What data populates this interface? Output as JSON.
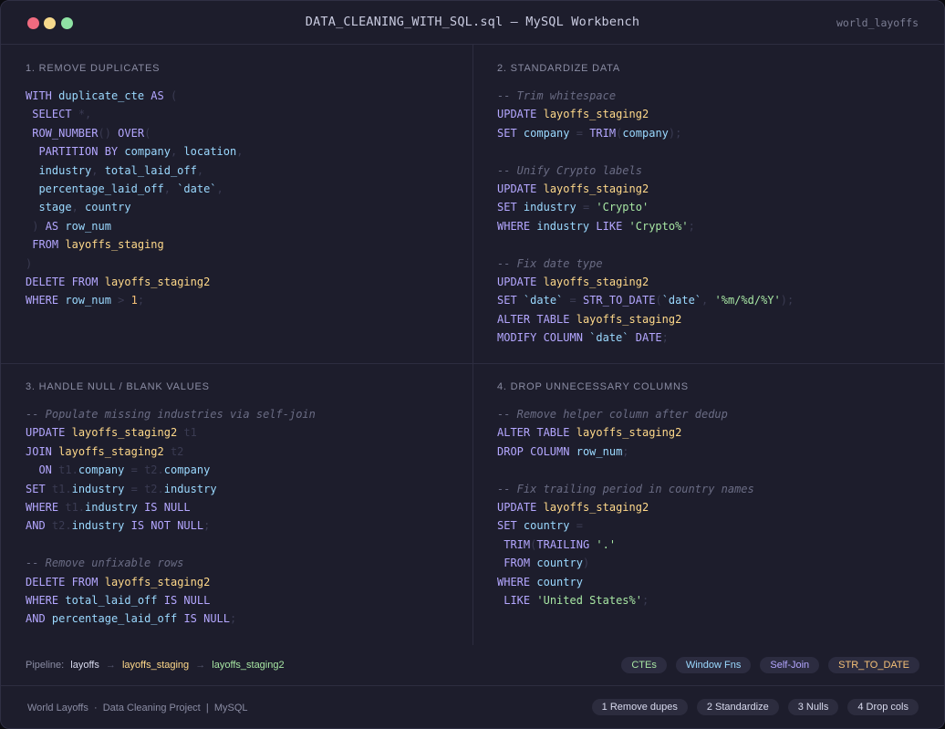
{
  "window": {
    "title": "DATA_CLEANING_WITH_SQL.sql  —  MySQL Workbench",
    "database": "world_layoffs",
    "traffic_lights": [
      "#f06b80",
      "#f6d98c",
      "#8fe3a4"
    ]
  },
  "panels": [
    {
      "title": "1. REMOVE DUPLICATES",
      "lines": [
        [
          [
            "kw",
            "WITH"
          ],
          [
            "p",
            " "
          ],
          [
            "id",
            "duplicate_cte"
          ],
          [
            "p",
            " "
          ],
          [
            "kw",
            "AS"
          ],
          [
            "p",
            " ("
          ]
        ],
        [
          [
            "p",
            " "
          ],
          [
            "kw",
            "SELECT"
          ],
          [
            "p",
            " *,"
          ]
        ],
        [
          [
            "p",
            " "
          ],
          [
            "kw",
            "ROW_NUMBER"
          ],
          [
            "p",
            "() "
          ],
          [
            "kw",
            "OVER"
          ],
          [
            "p",
            "("
          ]
        ],
        [
          [
            "p",
            "  "
          ],
          [
            "kw",
            "PARTITION BY"
          ],
          [
            "p",
            " "
          ],
          [
            "id",
            "company"
          ],
          [
            "p",
            ", "
          ],
          [
            "id",
            "location"
          ],
          [
            "p",
            ","
          ]
        ],
        [
          [
            "p",
            "  "
          ],
          [
            "id",
            "industry"
          ],
          [
            "p",
            ", "
          ],
          [
            "id",
            "total_laid_off"
          ],
          [
            "p",
            ","
          ]
        ],
        [
          [
            "p",
            "  "
          ],
          [
            "id",
            "percentage_laid_off"
          ],
          [
            "p",
            ", "
          ],
          [
            "id",
            "`date`"
          ],
          [
            "p",
            ","
          ]
        ],
        [
          [
            "p",
            "  "
          ],
          [
            "id",
            "stage"
          ],
          [
            "p",
            ", "
          ],
          [
            "id",
            "country"
          ]
        ],
        [
          [
            "p",
            " ) "
          ],
          [
            "kw",
            "AS"
          ],
          [
            "p",
            " "
          ],
          [
            "id",
            "row_num"
          ]
        ],
        [
          [
            "p",
            " "
          ],
          [
            "kw",
            "FROM"
          ],
          [
            "p",
            " "
          ],
          [
            "tb",
            "layoffs_staging"
          ]
        ],
        [
          [
            "p",
            ")"
          ]
        ],
        [
          [
            "kw",
            "DELETE FROM"
          ],
          [
            "p",
            " "
          ],
          [
            "tb",
            "layoffs_staging2"
          ]
        ],
        [
          [
            "kw",
            "WHERE"
          ],
          [
            "p",
            " "
          ],
          [
            "id",
            "row_num"
          ],
          [
            "p",
            " > "
          ],
          [
            "num",
            "1"
          ],
          [
            "p",
            ";"
          ]
        ]
      ]
    },
    {
      "title": "2. STANDARDIZE DATA",
      "lines": [
        [
          [
            "cm",
            "-- Trim whitespace"
          ]
        ],
        [
          [
            "kw",
            "UPDATE"
          ],
          [
            "p",
            " "
          ],
          [
            "tb",
            "layoffs_staging2"
          ]
        ],
        [
          [
            "kw",
            "SET"
          ],
          [
            "p",
            " "
          ],
          [
            "id",
            "company"
          ],
          [
            "p",
            " = "
          ],
          [
            "kw",
            "TRIM"
          ],
          [
            "p",
            "("
          ],
          [
            "id",
            "company"
          ],
          [
            "p",
            ");"
          ]
        ],
        [],
        [
          [
            "cm",
            "-- Unify Crypto labels"
          ]
        ],
        [
          [
            "kw",
            "UPDATE"
          ],
          [
            "p",
            " "
          ],
          [
            "tb",
            "layoffs_staging2"
          ]
        ],
        [
          [
            "kw",
            "SET"
          ],
          [
            "p",
            " "
          ],
          [
            "id",
            "industry"
          ],
          [
            "p",
            " = "
          ],
          [
            "str",
            "'Crypto'"
          ]
        ],
        [
          [
            "kw",
            "WHERE"
          ],
          [
            "p",
            " "
          ],
          [
            "id",
            "industry"
          ],
          [
            "p",
            " "
          ],
          [
            "kw",
            "LIKE"
          ],
          [
            "p",
            " "
          ],
          [
            "str",
            "'Crypto%'"
          ],
          [
            "p",
            ";"
          ]
        ],
        [],
        [
          [
            "cm",
            "-- Fix date type"
          ]
        ],
        [
          [
            "kw",
            "UPDATE"
          ],
          [
            "p",
            " "
          ],
          [
            "tb",
            "layoffs_staging2"
          ]
        ],
        [
          [
            "kw",
            "SET"
          ],
          [
            "p",
            " "
          ],
          [
            "id",
            "`date`"
          ],
          [
            "p",
            " = "
          ],
          [
            "kw",
            "STR_TO_DATE"
          ],
          [
            "p",
            "("
          ],
          [
            "id",
            "`date`"
          ],
          [
            "p",
            ", "
          ],
          [
            "str",
            "'%m/%d/%Y'"
          ],
          [
            "p",
            ");"
          ]
        ],
        [
          [
            "kw",
            "ALTER TABLE"
          ],
          [
            "p",
            " "
          ],
          [
            "tb",
            "layoffs_staging2"
          ]
        ],
        [
          [
            "kw",
            "MODIFY COLUMN"
          ],
          [
            "p",
            " "
          ],
          [
            "id",
            "`date`"
          ],
          [
            "p",
            " "
          ],
          [
            "kw",
            "DATE"
          ],
          [
            "p",
            ";"
          ]
        ]
      ]
    },
    {
      "title": "3. HANDLE NULL / BLANK VALUES",
      "lines": [
        [
          [
            "cm",
            "-- Populate missing industries via self-join"
          ]
        ],
        [
          [
            "kw",
            "UPDATE"
          ],
          [
            "p",
            " "
          ],
          [
            "tb",
            "layoffs_staging2"
          ],
          [
            "p",
            " t1"
          ]
        ],
        [
          [
            "kw",
            "JOIN"
          ],
          [
            "p",
            " "
          ],
          [
            "tb",
            "layoffs_staging2"
          ],
          [
            "p",
            " t2"
          ]
        ],
        [
          [
            "p",
            "  "
          ],
          [
            "kw",
            "ON"
          ],
          [
            "p",
            " t1."
          ],
          [
            "id",
            "company"
          ],
          [
            "p",
            " = t2."
          ],
          [
            "id",
            "company"
          ]
        ],
        [
          [
            "kw",
            "SET"
          ],
          [
            "p",
            " t1."
          ],
          [
            "id",
            "industry"
          ],
          [
            "p",
            " = t2."
          ],
          [
            "id",
            "industry"
          ]
        ],
        [
          [
            "kw",
            "WHERE"
          ],
          [
            "p",
            " t1."
          ],
          [
            "id",
            "industry"
          ],
          [
            "p",
            " "
          ],
          [
            "kw",
            "IS NULL"
          ]
        ],
        [
          [
            "kw",
            "AND"
          ],
          [
            "p",
            " t2."
          ],
          [
            "id",
            "industry"
          ],
          [
            "p",
            " "
          ],
          [
            "kw",
            "IS NOT NULL"
          ],
          [
            "p",
            ";"
          ]
        ],
        [],
        [
          [
            "cm",
            "-- Remove unfixable rows"
          ]
        ],
        [
          [
            "kw",
            "DELETE FROM"
          ],
          [
            "p",
            " "
          ],
          [
            "tb",
            "layoffs_staging2"
          ]
        ],
        [
          [
            "kw",
            "WHERE"
          ],
          [
            "p",
            " "
          ],
          [
            "id",
            "total_laid_off"
          ],
          [
            "p",
            " "
          ],
          [
            "kw",
            "IS NULL"
          ]
        ],
        [
          [
            "kw",
            "AND"
          ],
          [
            "p",
            " "
          ],
          [
            "id",
            "percentage_laid_off"
          ],
          [
            "p",
            " "
          ],
          [
            "kw",
            "IS NULL"
          ],
          [
            "p",
            ";"
          ]
        ]
      ]
    },
    {
      "title": "4. DROP UNNECESSARY COLUMNS",
      "lines": [
        [
          [
            "cm",
            "-- Remove helper column after dedup"
          ]
        ],
        [
          [
            "kw",
            "ALTER TABLE"
          ],
          [
            "p",
            " "
          ],
          [
            "tb",
            "layoffs_staging2"
          ]
        ],
        [
          [
            "kw",
            "DROP COLUMN"
          ],
          [
            "p",
            " "
          ],
          [
            "id",
            "row_num"
          ],
          [
            "p",
            ";"
          ]
        ],
        [],
        [
          [
            "cm",
            "-- Fix trailing period in country names"
          ]
        ],
        [
          [
            "kw",
            "UPDATE"
          ],
          [
            "p",
            " "
          ],
          [
            "tb",
            "layoffs_staging2"
          ]
        ],
        [
          [
            "kw",
            "SET"
          ],
          [
            "p",
            " "
          ],
          [
            "id",
            "country"
          ],
          [
            "p",
            " ="
          ]
        ],
        [
          [
            "p",
            " "
          ],
          [
            "kw",
            "TRIM"
          ],
          [
            "p",
            "("
          ],
          [
            "kw",
            "TRAILING"
          ],
          [
            "p",
            " "
          ],
          [
            "str",
            "'.'"
          ]
        ],
        [
          [
            "p",
            " "
          ],
          [
            "kw",
            "FROM"
          ],
          [
            "p",
            " "
          ],
          [
            "id",
            "country"
          ],
          [
            "p",
            ")"
          ]
        ],
        [
          [
            "kw",
            "WHERE"
          ],
          [
            "p",
            " "
          ],
          [
            "id",
            "country"
          ]
        ],
        [
          [
            "p",
            " "
          ],
          [
            "kw",
            "LIKE"
          ],
          [
            "p",
            " "
          ],
          [
            "str",
            "'United States%'"
          ],
          [
            "p",
            ";"
          ]
        ]
      ]
    }
  ],
  "pipeline": {
    "label": "Pipeline:",
    "stages": [
      "layoffs",
      "layoffs_staging",
      "layoffs_staging2"
    ],
    "arrow": "→"
  },
  "tags": [
    {
      "label": "CTEs",
      "color": "#a7e6a3"
    },
    {
      "label": "Window Fns",
      "color": "#9bd9ff"
    },
    {
      "label": "Self-Join",
      "color": "#b4a7ff"
    },
    {
      "label": "STR_TO_DATE",
      "color": "#f6c177"
    }
  ],
  "footer": {
    "text": "World Layoffs  ·  Data Cleaning Project  |  MySQL",
    "steps": [
      "1 Remove dupes",
      "2 Standardize",
      "3 Nulls",
      "4 Drop cols"
    ]
  }
}
